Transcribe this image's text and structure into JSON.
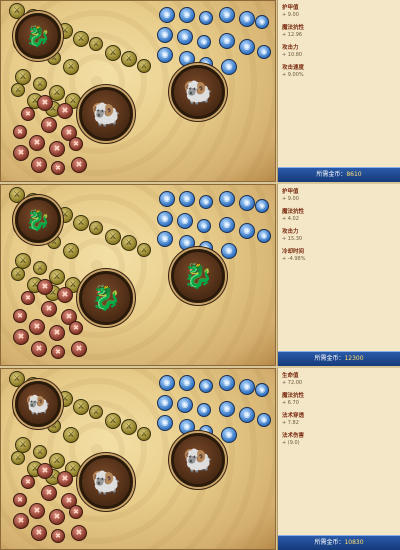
{
  "panels": [
    {
      "stats": [
        {
          "name": "护甲值",
          "value": "+ 9.00"
        },
        {
          "name": "魔法抗性",
          "value": "+ 12.96"
        },
        {
          "name": "攻击力",
          "value": "+ 10.80"
        },
        {
          "name": "攻击速度",
          "value": "+ 9.00%"
        }
      ],
      "cost_label": "所需金币：",
      "cost_value": "8610",
      "masteries": {
        "top_left": "dragon",
        "center_left": "ram",
        "right": "ram"
      }
    },
    {
      "stats": [
        {
          "name": "护甲值",
          "value": "+ 9.00"
        },
        {
          "name": "魔法抗性",
          "value": "+ 4.02"
        },
        {
          "name": "攻击力",
          "value": "+ 15.30"
        },
        {
          "name": "冷却时间",
          "value": "+ -4.98%"
        }
      ],
      "cost_label": "所需金币：",
      "cost_value": "12300",
      "masteries": {
        "top_left": "dragon",
        "center_left": "dragon",
        "right": "dragon"
      }
    },
    {
      "stats": [
        {
          "name": "生命值",
          "value": "+ 72.00"
        },
        {
          "name": "魔法抗性",
          "value": "+ 6.70"
        },
        {
          "name": "法术穿透",
          "value": "+ 7.82"
        },
        {
          "name": "法术伤害",
          "value": "+ (9.0)"
        }
      ],
      "cost_label": "所需金币：",
      "cost_value": "10830",
      "masteries": {
        "top_left": "ram",
        "center_left": "ram",
        "right": "ram"
      }
    }
  ],
  "icons": {
    "dragon": "🐉",
    "ram": "🐏",
    "yellow": "⚔",
    "blue": "◉",
    "red": "✖"
  }
}
